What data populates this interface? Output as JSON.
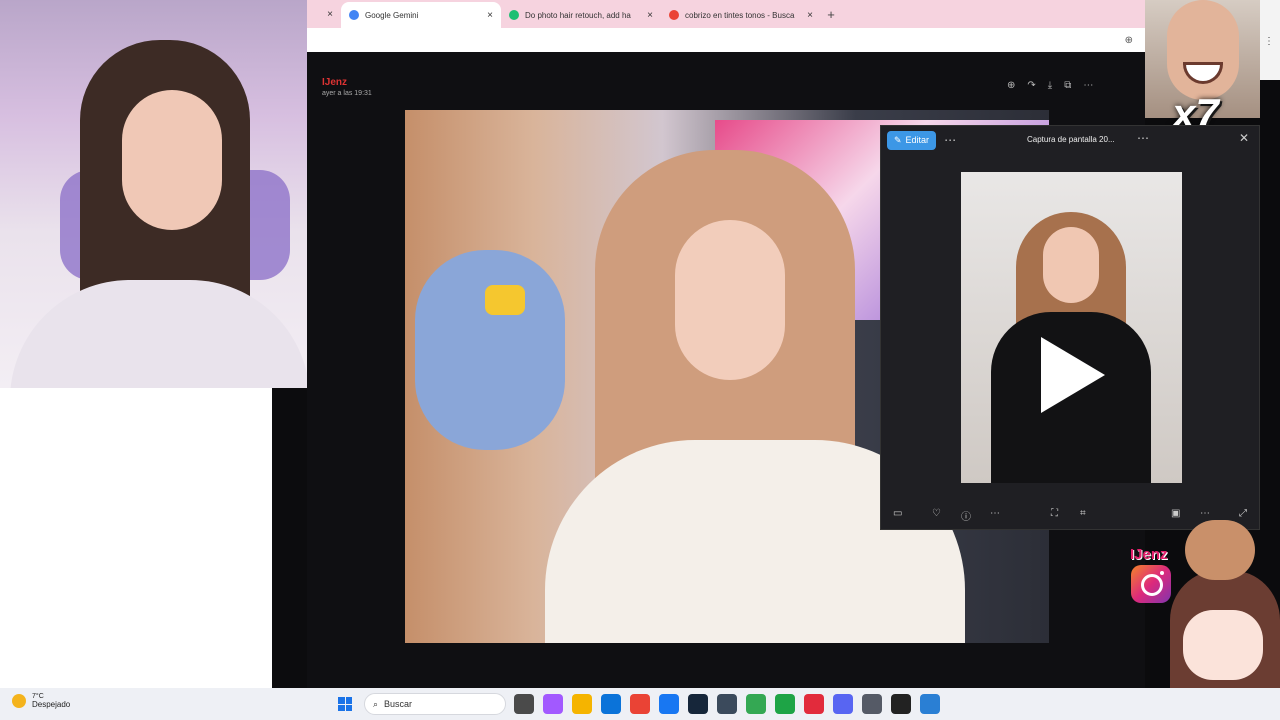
{
  "browser": {
    "tabs": [
      {
        "label": "Google Gemini",
        "color": "#4285f4",
        "active": true
      },
      {
        "label": "Do photo hair retouch, add ha",
        "color": "#1dbf73",
        "active": false
      },
      {
        "label": "cobrizo en tintes tonos - Busca",
        "color": "#ea4335",
        "active": false
      }
    ],
    "new_tab": "+",
    "close": "×"
  },
  "viewer": {
    "sender_name": "IJenz",
    "sender_time": "ayer a las 19:31",
    "tools": [
      "⊕",
      "↷",
      "⤓",
      "⧉",
      "⋯"
    ]
  },
  "photos_app": {
    "edit_label": "Editar",
    "more": "⋯",
    "title": "Captura de pantalla 20...",
    "close": "✕",
    "bottom_icons": [
      "▭",
      "♡",
      "ⓘ",
      "⋯",
      "⛶",
      "⌗",
      "▣",
      "⋯",
      "⤢"
    ]
  },
  "overlay": {
    "multiplier": "x7",
    "instagram_handle": "IJenz"
  },
  "taskbar": {
    "temperature": "7°C",
    "weather": "Despejado",
    "search_placeholder": "Buscar",
    "app_colors": [
      "#4a4a4a",
      "#a259ff",
      "#f5b400",
      "#0b73d9",
      "#ea4335",
      "#1877f2",
      "#16263a",
      "#3b4a5c",
      "#34a853",
      "#1ea446",
      "#e22b3c",
      "#5865f2",
      "#555a66",
      "#222222",
      "#2a7fd4"
    ]
  }
}
